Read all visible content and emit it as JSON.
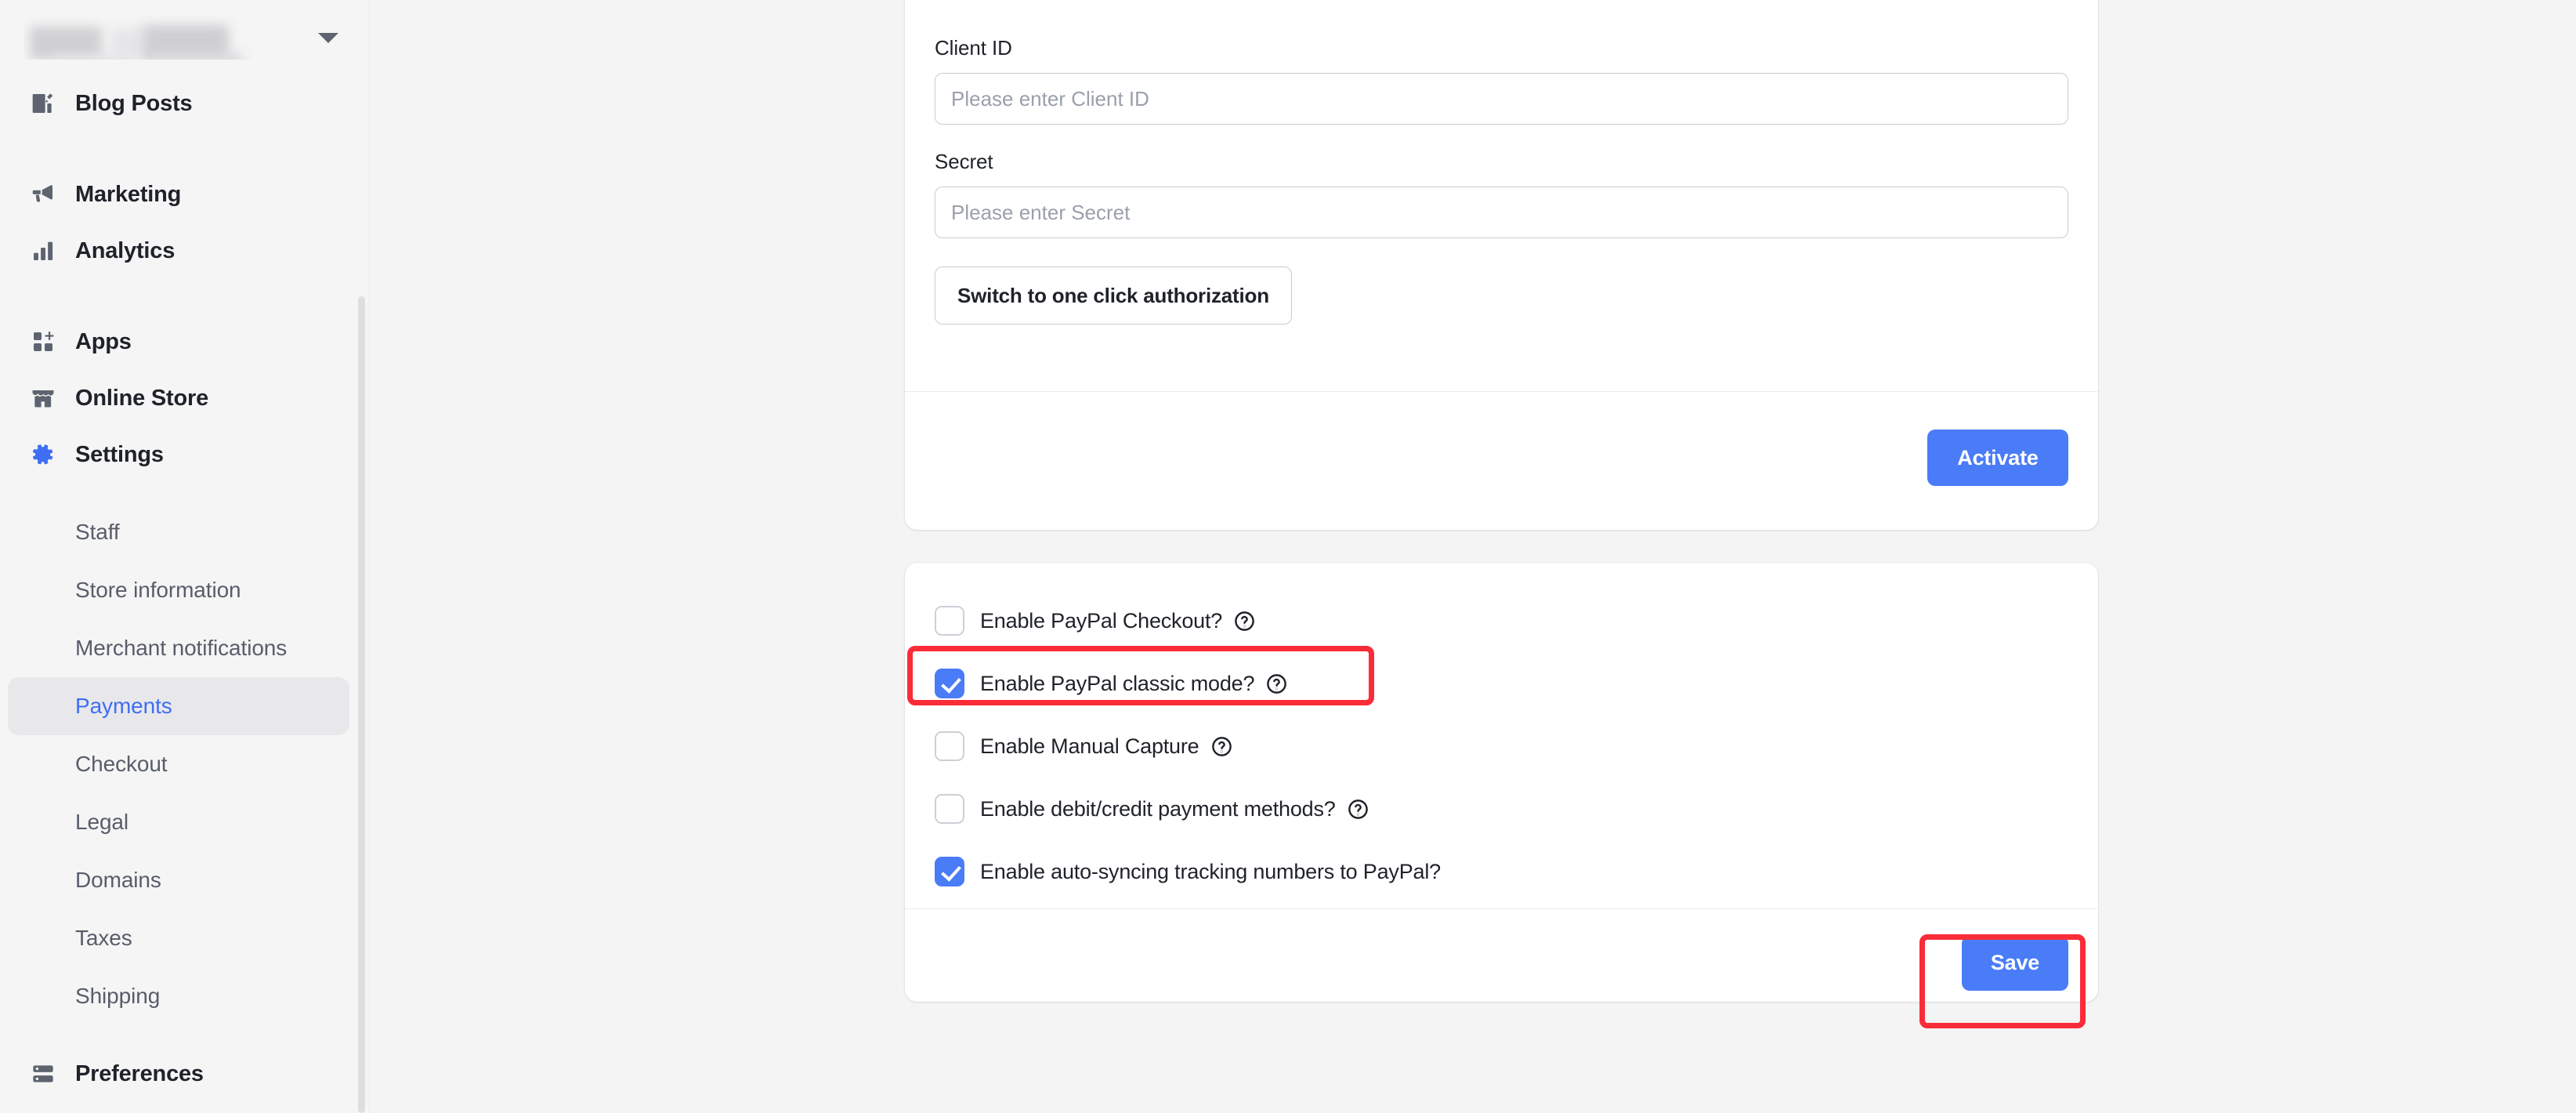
{
  "sidebar": {
    "store_switcher": {
      "name_redacted": "",
      "chevron_icon": "chevron-down-icon"
    },
    "primary_items": [
      {
        "label": "Blog Posts",
        "icon": "blog-posts-icon",
        "active": false
      },
      {
        "label": "Marketing",
        "icon": "megaphone-icon",
        "active": false
      },
      {
        "label": "Analytics",
        "icon": "bar-chart-icon",
        "active": false
      },
      {
        "label": "Apps",
        "icon": "apps-grid-icon",
        "active": false
      },
      {
        "label": "Online Store",
        "icon": "storefront-icon",
        "active": false
      },
      {
        "label": "Settings",
        "icon": "gear-icon",
        "active": true
      },
      {
        "label": "Preferences",
        "icon": "preferences-list-icon",
        "active": false
      }
    ],
    "settings_subitems": [
      {
        "label": "Staff",
        "active": false
      },
      {
        "label": "Store information",
        "active": false
      },
      {
        "label": "Merchant notifications",
        "active": false
      },
      {
        "label": "Payments",
        "active": true
      },
      {
        "label": "Checkout",
        "active": false
      },
      {
        "label": "Legal",
        "active": false
      },
      {
        "label": "Domains",
        "active": false
      },
      {
        "label": "Taxes",
        "active": false
      },
      {
        "label": "Shipping",
        "active": false
      }
    ]
  },
  "credentials_card": {
    "client_id": {
      "label": "Client ID",
      "value": "",
      "placeholder": "Please enter Client ID"
    },
    "secret": {
      "label": "Secret",
      "value": "",
      "placeholder": "Please enter Secret"
    },
    "switch_auth_button": "Switch to one click authorization",
    "activate_button": "Activate"
  },
  "options_card": {
    "checkboxes": [
      {
        "label": "Enable PayPal Checkout?",
        "checked": false,
        "has_help": true,
        "highlighted": false
      },
      {
        "label": "Enable PayPal classic mode?",
        "checked": true,
        "has_help": true,
        "highlighted": true
      },
      {
        "label": "Enable Manual Capture",
        "checked": false,
        "has_help": true,
        "highlighted": false
      },
      {
        "label": "Enable debit/credit payment methods?",
        "checked": false,
        "has_help": true,
        "highlighted": false
      },
      {
        "label": "Enable auto-syncing tracking numbers to PayPal?",
        "checked": true,
        "has_help": false,
        "highlighted": false
      }
    ],
    "save_button": "Save"
  },
  "colors": {
    "accent_blue": "#4a7cf7",
    "active_nav_blue": "#3f6ef5",
    "annotation_red": "#fa2c37",
    "page_background": "#f4f4f5",
    "sidebar_background": "#f5f5f6",
    "card_background": "#ffffff",
    "text_primary": "#1f2229",
    "text_muted": "#575d69",
    "placeholder": "#9aa0ab"
  }
}
